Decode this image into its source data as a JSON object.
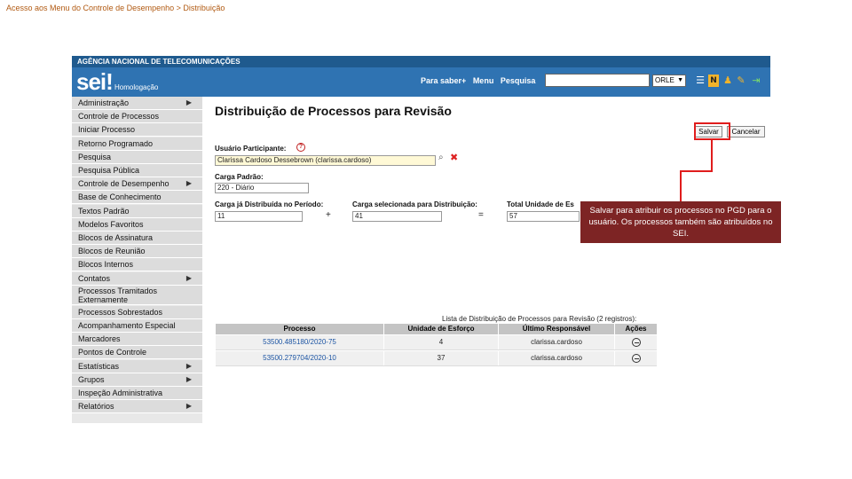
{
  "slide": {
    "caption": "Acesso aos Menu do Controle de Desempenho > Distribuição"
  },
  "header": {
    "agency": "AGÊNCIA NACIONAL DE TELECOMUNICAÇÕES",
    "logo": "sei!",
    "environment": "Homologação",
    "links": [
      "Para saber+",
      "Menu",
      "Pesquisa"
    ],
    "search_value": "",
    "unit": "ORLE",
    "icons": [
      "list-icon",
      "notification-icon",
      "user-icon",
      "pen-icon",
      "exit-icon"
    ]
  },
  "sidebar": {
    "items": [
      {
        "label": "Administração",
        "submenu": true
      },
      {
        "label": "Controle de Processos",
        "submenu": false
      },
      {
        "label": "Iniciar Processo",
        "submenu": false
      },
      {
        "label": "Retorno Programado",
        "submenu": false
      },
      {
        "label": "Pesquisa",
        "submenu": false
      },
      {
        "label": "Pesquisa Pública",
        "submenu": false
      },
      {
        "label": "Controle de Desempenho",
        "submenu": true
      },
      {
        "label": "Base de Conhecimento",
        "submenu": false
      },
      {
        "label": "Textos Padrão",
        "submenu": false
      },
      {
        "label": "Modelos Favoritos",
        "submenu": false
      },
      {
        "label": "Blocos de Assinatura",
        "submenu": false
      },
      {
        "label": "Blocos de Reunião",
        "submenu": false
      },
      {
        "label": "Blocos Internos",
        "submenu": false
      },
      {
        "label": "Contatos",
        "submenu": true
      },
      {
        "label": "Processos Tramitados Externamente",
        "submenu": false
      },
      {
        "label": "Processos Sobrestados",
        "submenu": false
      },
      {
        "label": "Acompanhamento Especial",
        "submenu": false
      },
      {
        "label": "Marcadores",
        "submenu": false
      },
      {
        "label": "Pontos de Controle",
        "submenu": false
      },
      {
        "label": "Estatísticas",
        "submenu": true
      },
      {
        "label": "Grupos",
        "submenu": true
      },
      {
        "label": "Inspeção Administrativa",
        "submenu": false
      },
      {
        "label": "Relatórios",
        "submenu": true
      }
    ],
    "arrow": "▶"
  },
  "page": {
    "title": "Distribuição de Processos para Revisão",
    "save_label": "Salvar",
    "cancel_label": "Cancelar",
    "participant_label": "Usuário Participante:",
    "participant_value": "Clarissa Cardoso Dessebrown (clarissa.cardoso)",
    "standard_load_label": "Carga Padrão:",
    "standard_load_value": "220 - Diário",
    "distributed_label": "Carga já Distribuída no Período:",
    "distributed_value": "11",
    "selected_label": "Carga selecionada para Distribuição:",
    "selected_value": "41",
    "total_label": "Total Unidade de Es",
    "total_value": "57",
    "plus": "+",
    "equals": "="
  },
  "table": {
    "caption": "Lista de Distribuição de Processos para Revisão (2 registros):",
    "headers": [
      "Processo",
      "Unidade de Esforço",
      "Último Responsável",
      "Ações"
    ],
    "rows": [
      {
        "process": "53500.485180/2020-75",
        "effort": "4",
        "responsible": "clarissa.cardoso"
      },
      {
        "process": "53500.279704/2020-10",
        "effort": "37",
        "responsible": "clarissa.cardoso"
      }
    ]
  },
  "callout": {
    "text": "Salvar para atribuir os processos no PGD para o usuário. Os processos também são atribuídos no SEI.",
    "color": "#7d2424",
    "highlight_color": "#e01d1d"
  }
}
